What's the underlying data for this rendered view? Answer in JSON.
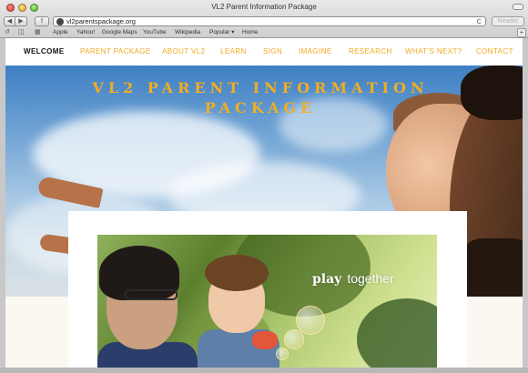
{
  "browser": {
    "window_title": "VL2 Parent Information Package",
    "url": "vl2parentspackage.org",
    "reader_label": "Reader",
    "reload_glyph": "C",
    "back_glyph": "◀",
    "forward_glyph": "▶",
    "share_glyph": "⇪",
    "bookmarks": [
      "Apple",
      "Yahoo!",
      "Google Maps",
      "YouTube",
      "Wikipedia",
      "Popular ▾",
      "Home"
    ],
    "bookmark_icons": [
      "reading-list-icon",
      "bookmarks-book-icon",
      "top-sites-grid-icon"
    ],
    "add_glyph": "+"
  },
  "site": {
    "nav": [
      "WELCOME",
      "PARENT PACKAGE",
      "ABOUT VL2",
      "LEARN",
      "SIGN",
      "IMAGINE",
      "RESEARCH",
      "WHAT'S NEXT?",
      "CONTACT"
    ],
    "hero_title": "VL2 PARENT INFORMATION PACKAGE",
    "photo_caption_bold": "play",
    "photo_caption_light": "together"
  },
  "colors": {
    "accent": "#f2ad22",
    "nav_active": "#111111",
    "page_background": "#fbf7f1"
  }
}
